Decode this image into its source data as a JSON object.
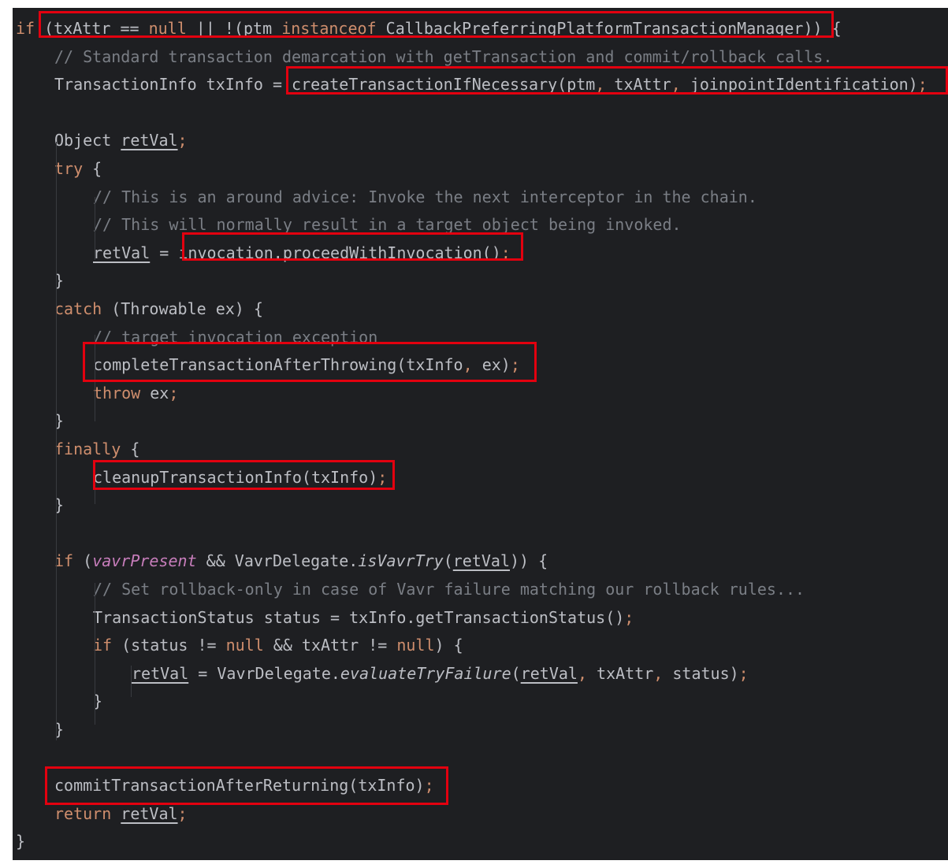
{
  "colors": {
    "background": "#1e1f22",
    "default_text": "#bcbec4",
    "keyword": "#cf8e6d",
    "comment": "#7a7e85",
    "method_declaration": "#56a8f5",
    "field_italic": "#c77dbb",
    "highlight_box": "#e3000f"
  },
  "code_lines": [
    {
      "indent": 0,
      "tokens": [
        {
          "t": "if",
          "k": "kw"
        },
        {
          "t": " (txAttr == "
        },
        {
          "t": "null",
          "k": "kw"
        },
        {
          "t": " || !(ptm "
        },
        {
          "t": "instanceof",
          "k": "kw"
        },
        {
          "t": " CallbackPreferringPlatformTransactionManager)) {"
        }
      ]
    },
    {
      "indent": 1,
      "tokens": [
        {
          "t": "// Standard transaction demarcation with getTransaction and commit/rollback calls.",
          "k": "cmt"
        }
      ]
    },
    {
      "indent": 1,
      "tokens": [
        {
          "t": "TransactionInfo txInfo = createTransactionIfNecessary(ptm"
        },
        {
          "t": ",",
          "k": "punct"
        },
        {
          "t": " txAttr"
        },
        {
          "t": ",",
          "k": "punct"
        },
        {
          "t": " joinpointIdentification)"
        },
        {
          "t": ";",
          "k": "punct"
        }
      ]
    },
    {
      "indent": 0,
      "tokens": []
    },
    {
      "indent": 1,
      "tokens": [
        {
          "t": "Object "
        },
        {
          "t": "retVal",
          "k": "ul"
        },
        {
          "t": ";",
          "k": "punct"
        }
      ]
    },
    {
      "indent": 1,
      "tokens": [
        {
          "t": "try",
          "k": "kw"
        },
        {
          "t": " {"
        }
      ]
    },
    {
      "indent": 2,
      "tokens": [
        {
          "t": "// This is an around advice: Invoke the next interceptor in the chain.",
          "k": "cmt"
        }
      ]
    },
    {
      "indent": 2,
      "tokens": [
        {
          "t": "// This will normally result in a target object being invoked.",
          "k": "cmt"
        }
      ]
    },
    {
      "indent": 2,
      "tokens": [
        {
          "t": "retVal",
          "k": "ul"
        },
        {
          "t": " = invocation.proceedWithInvocation()"
        },
        {
          "t": ";",
          "k": "punct"
        }
      ]
    },
    {
      "indent": 1,
      "tokens": [
        {
          "t": "}"
        }
      ]
    },
    {
      "indent": 1,
      "tokens": [
        {
          "t": "catch",
          "k": "kw"
        },
        {
          "t": " (Throwable ex) {"
        }
      ]
    },
    {
      "indent": 2,
      "tokens": [
        {
          "t": "// target invocation exception",
          "k": "cmt"
        }
      ]
    },
    {
      "indent": 2,
      "tokens": [
        {
          "t": "completeTransactionAfterThrowing(txInfo"
        },
        {
          "t": ",",
          "k": "punct"
        },
        {
          "t": " ex)"
        },
        {
          "t": ";",
          "k": "punct"
        }
      ]
    },
    {
      "indent": 2,
      "tokens": [
        {
          "t": "throw",
          "k": "kw"
        },
        {
          "t": " ex"
        },
        {
          "t": ";",
          "k": "punct"
        }
      ]
    },
    {
      "indent": 1,
      "tokens": [
        {
          "t": "}"
        }
      ]
    },
    {
      "indent": 1,
      "tokens": [
        {
          "t": "finally",
          "k": "kw"
        },
        {
          "t": " {"
        }
      ]
    },
    {
      "indent": 2,
      "tokens": [
        {
          "t": "cleanupTransactionInfo(txInfo)"
        },
        {
          "t": ";",
          "k": "punct"
        }
      ]
    },
    {
      "indent": 1,
      "tokens": [
        {
          "t": "}"
        }
      ]
    },
    {
      "indent": 0,
      "tokens": []
    },
    {
      "indent": 1,
      "tokens": [
        {
          "t": "if",
          "k": "kw"
        },
        {
          "t": " ("
        },
        {
          "t": "vavrPresent",
          "k": "field"
        },
        {
          "t": " && VavrDelegate."
        },
        {
          "t": "isVavrTry",
          "k": "ital"
        },
        {
          "t": "("
        },
        {
          "t": "retVal",
          "k": "ul"
        },
        {
          "t": ")) {"
        }
      ]
    },
    {
      "indent": 2,
      "tokens": [
        {
          "t": "// Set rollback-only in case of Vavr failure matching our rollback rules...",
          "k": "cmt"
        }
      ]
    },
    {
      "indent": 2,
      "tokens": [
        {
          "t": "TransactionStatus status = txInfo.getTransactionStatus()"
        },
        {
          "t": ";",
          "k": "punct"
        }
      ]
    },
    {
      "indent": 2,
      "tokens": [
        {
          "t": "if",
          "k": "kw"
        },
        {
          "t": " (status != "
        },
        {
          "t": "null",
          "k": "kw"
        },
        {
          "t": " && txAttr != "
        },
        {
          "t": "null",
          "k": "kw"
        },
        {
          "t": ") {"
        }
      ]
    },
    {
      "indent": 3,
      "tokens": [
        {
          "t": "retVal",
          "k": "ul"
        },
        {
          "t": " = VavrDelegate."
        },
        {
          "t": "evaluateTryFailure",
          "k": "ital"
        },
        {
          "t": "("
        },
        {
          "t": "retVal",
          "k": "ul"
        },
        {
          "t": ",",
          "k": "punct"
        },
        {
          "t": " txAttr"
        },
        {
          "t": ",",
          "k": "punct"
        },
        {
          "t": " status)"
        },
        {
          "t": ";",
          "k": "punct"
        }
      ]
    },
    {
      "indent": 2,
      "tokens": [
        {
          "t": "}"
        }
      ]
    },
    {
      "indent": 1,
      "tokens": [
        {
          "t": "}"
        }
      ]
    },
    {
      "indent": 0,
      "tokens": []
    },
    {
      "indent": 1,
      "tokens": [
        {
          "t": "commitTransactionAfterReturning(txInfo)"
        },
        {
          "t": ";",
          "k": "punct"
        }
      ]
    },
    {
      "indent": 1,
      "tokens": [
        {
          "t": "return",
          "k": "kw"
        },
        {
          "t": " "
        },
        {
          "t": "retVal",
          "k": "ul"
        },
        {
          "t": ";",
          "k": "punct"
        }
      ]
    },
    {
      "indent": 0,
      "tokens": [
        {
          "t": "}"
        }
      ]
    }
  ],
  "highlighted_statements": [
    "(txAttr == null || !(ptm instanceof CallbackPreferringPlatformTransactionManager))",
    "createTransactionIfNecessary(ptm, txAttr, joinpointIdentification);",
    "invocation.proceedWithInvocation();",
    "completeTransactionAfterThrowing(txInfo, ex);",
    "cleanupTransactionInfo(txInfo);",
    "commitTransactionAfterReturning(txInfo);"
  ]
}
